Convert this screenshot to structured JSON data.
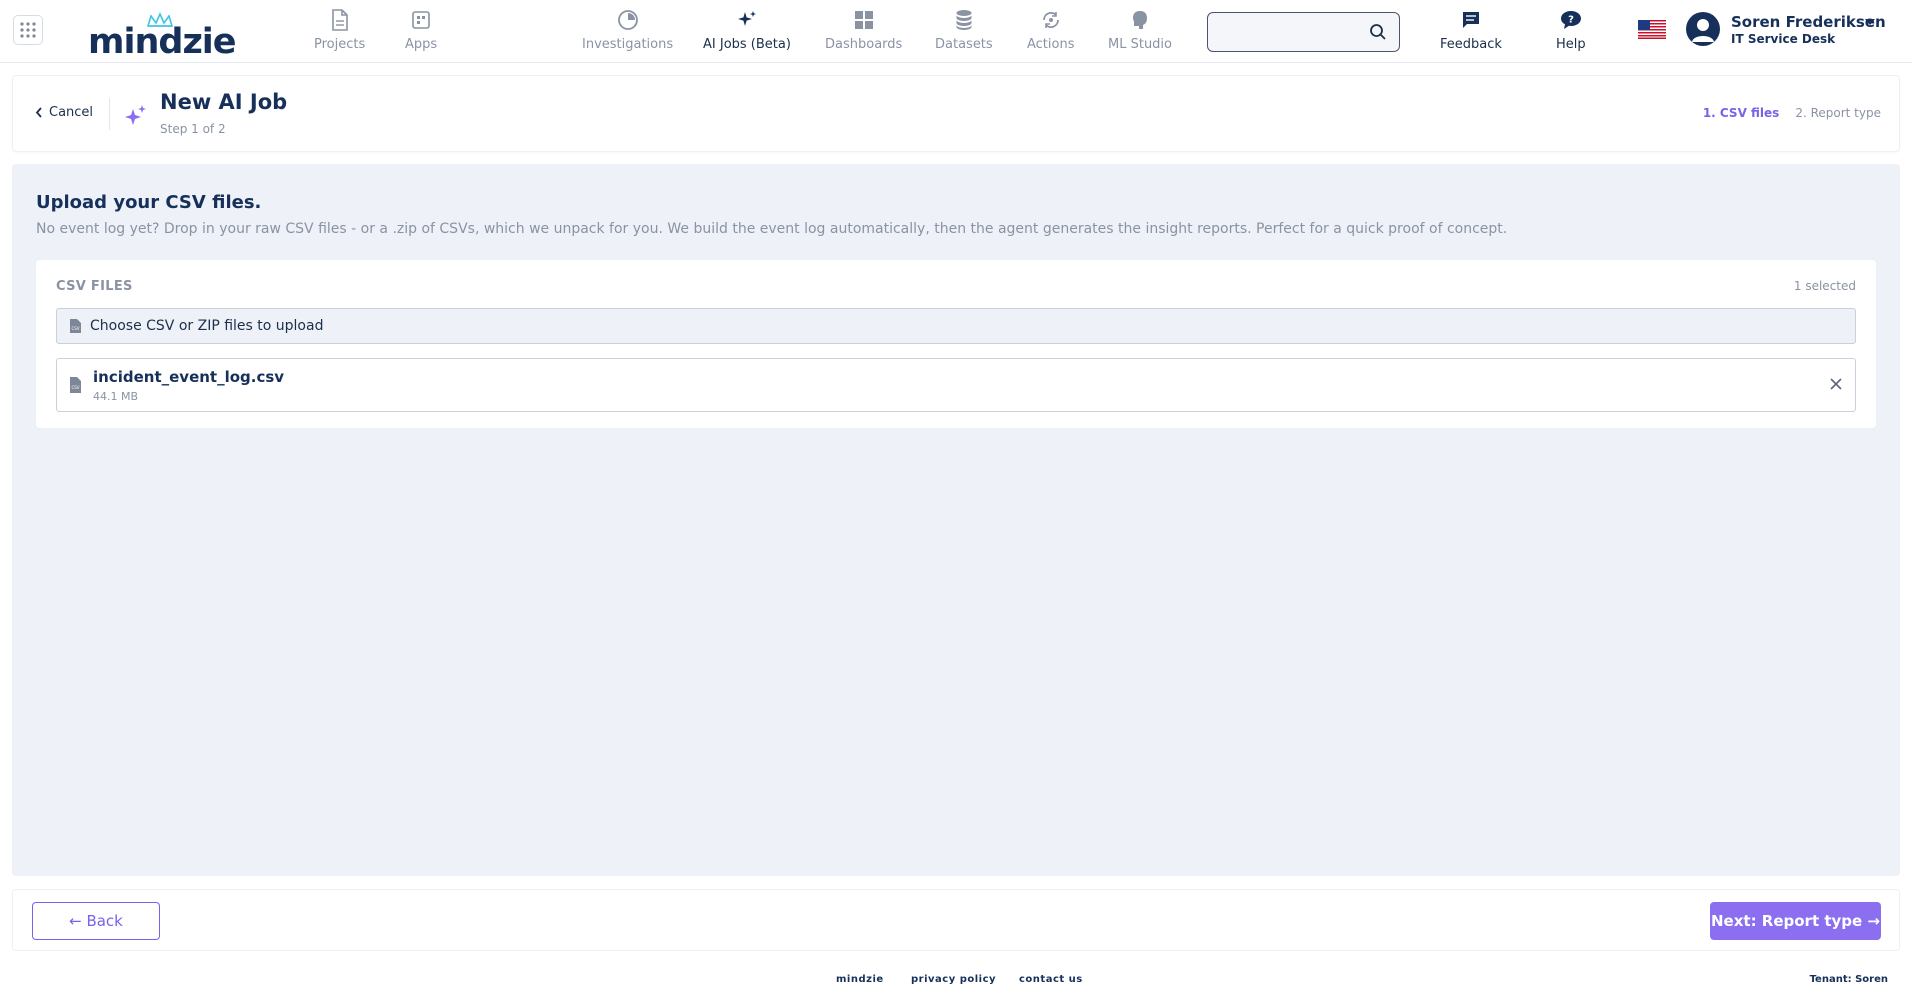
{
  "app": {
    "logo_text": "mindzie"
  },
  "nav": {
    "items": [
      {
        "label": "Projects",
        "icon": "document-icon"
      },
      {
        "label": "Apps",
        "icon": "apps-icon"
      },
      {
        "label": "Investigations",
        "icon": "investigations-icon"
      },
      {
        "label": "AI Jobs (Beta)",
        "icon": "sparkle-icon",
        "active": true
      },
      {
        "label": "Dashboards",
        "icon": "dashboards-icon"
      },
      {
        "label": "Datasets",
        "icon": "database-icon"
      },
      {
        "label": "Actions",
        "icon": "actions-icon"
      },
      {
        "label": "ML Studio",
        "icon": "brain-icon"
      },
      {
        "label": "Feedback",
        "icon": "feedback-icon"
      },
      {
        "label": "Help",
        "icon": "help-icon"
      }
    ]
  },
  "search": {
    "value": "",
    "placeholder": ""
  },
  "user": {
    "name": "Soren Frederiksen",
    "tenant": "IT Service Desk"
  },
  "header": {
    "cancel_label": "Cancel",
    "title": "New AI Job",
    "step_text": "Step 1 of 2",
    "steps": [
      "1. CSV files",
      "2. Report type"
    ]
  },
  "main": {
    "title": "Upload your CSV files.",
    "description": "No event log yet? Drop in your raw CSV files - or a .zip of CSVs, which we unpack for you. We build the event log automatically, then the agent generates the insight reports. Perfect for a quick proof of concept.",
    "card_label": "CSV FILES",
    "selected_count": "1 selected",
    "chooser_label": "Choose CSV or ZIP files to upload",
    "files": [
      {
        "name": "incident_event_log.csv",
        "size": "44.1 MB"
      }
    ]
  },
  "actions": {
    "back_label": "← Back",
    "next_label": "Next: Report type →"
  },
  "footer": {
    "links": [
      "mindzie",
      "privacy policy",
      "contact us"
    ],
    "tenant": "Tenant: Soren"
  },
  "colors": {
    "accent": "#7b61e8",
    "navy": "#16305a",
    "muted": "#8a93a3",
    "panel_bg": "#eef1f8"
  }
}
